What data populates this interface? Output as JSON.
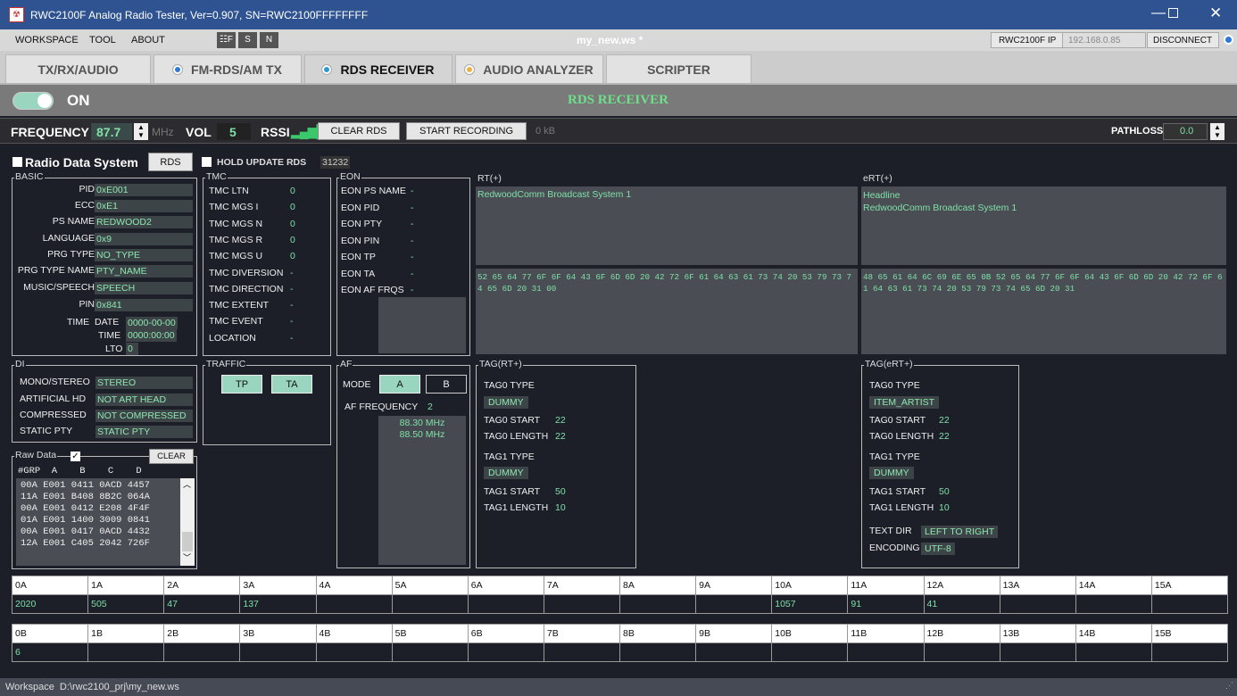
{
  "window": {
    "title": "RWC2100F Analog Radio Tester, Ver=0.907, SN=RWC2100FFFFFFFF"
  },
  "menu": {
    "items": [
      "WORKSPACE",
      "TOOL",
      "ABOUT"
    ],
    "workspace_name": "my_new.ws *",
    "ip_label": "RWC2100F IP",
    "ip_value": "192.168.0.85",
    "disconnect": "DISCONNECT"
  },
  "tabs": [
    {
      "label": "TX/RX/AUDIO"
    },
    {
      "label": "FM-RDS/AM TX"
    },
    {
      "label": "RDS RECEIVER"
    },
    {
      "label": "AUDIO ANALYZER"
    },
    {
      "label": "SCRIPTER"
    }
  ],
  "onbar": {
    "toggle": "ON",
    "title": "RDS RECEIVER"
  },
  "freqbar": {
    "freq_label": "FREQUENCY",
    "freq": "87.7",
    "unit": "MHz",
    "vol_label": "VOL",
    "vol": "5",
    "rssi_label": "RSSI",
    "clear_rds": "CLEAR RDS",
    "start_rec": "START RECORDING",
    "size": "0 kB",
    "pathloss_label": "PATHLOSS",
    "pathloss": "0.0"
  },
  "rds": {
    "title": "Radio Data System",
    "rds_btn": "RDS",
    "hold": "HOLD UPDATE RDS",
    "hold_count": "31232"
  },
  "basic": {
    "label": "BASIC",
    "pid_l": "PID",
    "pid": "0xE001",
    "ecc_l": "ECC",
    "ecc": "0xE1",
    "ps_l": "PS NAME",
    "ps": "REDWOOD2",
    "lang_l": "LANGUAGE",
    "lang": "0x9",
    "pty_l": "PRG TYPE",
    "pty": "NO_TYPE",
    "ptyn_l": "PRG TYPE NAME",
    "ptyn": "PTY_NAME",
    "ms_l": "MUSIC/SPEECH",
    "ms": "SPEECH",
    "pin_l": "PIN",
    "pin": "0x841",
    "time_l": "TIME",
    "date_l": "DATE",
    "date": "0000-00-00",
    "tm_l": "TIME",
    "tm": "0000:00:00",
    "lto_l": "LTO",
    "lto": "0"
  },
  "tmc": {
    "label": "TMC",
    "rows": [
      [
        "TMC LTN",
        "0"
      ],
      [
        "TMC MGS I",
        "0"
      ],
      [
        "TMC MGS N",
        "0"
      ],
      [
        "TMC MGS R",
        "0"
      ],
      [
        "TMC MGS U",
        "0"
      ],
      [
        "TMC DIVERSION",
        "-"
      ],
      [
        "TMC DIRECTION",
        "-"
      ],
      [
        "TMC EXTENT",
        "-"
      ],
      [
        "TMC EVENT",
        "-"
      ],
      [
        "LOCATION",
        "-"
      ]
    ]
  },
  "eon": {
    "label": "EON",
    "rows": [
      [
        "EON PS NAME",
        "-"
      ],
      [
        "EON PID",
        "-"
      ],
      [
        "EON PTY",
        "-"
      ],
      [
        "EON PIN",
        "-"
      ],
      [
        "EON TP",
        "-"
      ],
      [
        "EON TA",
        "-"
      ],
      [
        "EON AF FRQS",
        "-"
      ]
    ]
  },
  "rt": {
    "label": "RT(+)",
    "text": "RedwoodComm Broadcast System 1",
    "hex": "52 65 64 77 6F 6F 64 43 6F 6D 6D 20 42 72 6F 61 64 63 61 73 74 20 53 79 73 74 65 6D 20 31 00"
  },
  "ert": {
    "label": "eRT(+)",
    "text1": "Headline",
    "text2": "RedwoodComm Broadcast System 1",
    "hex": "48 65 61 64 6C 69 6E 65 0B 52 65 64 77 6F 6F 64 43 6F 6D 6D 20 42 72 6F 61 64 63 61 73 74 20 53 79 73 74 65 6D 20 31"
  },
  "di": {
    "label": "DI",
    "ms_l": "MONO/STEREO",
    "ms": "STEREO",
    "ah_l": "ARTIFICIAL HD",
    "ah": "NOT ART HEAD",
    "cp_l": "COMPRESSED",
    "cp": "NOT COMPRESSED",
    "sp_l": "STATIC PTY",
    "sp": "STATIC PTY"
  },
  "traffic": {
    "label": "TRAFFIC",
    "tp": "TP",
    "ta": "TA"
  },
  "af": {
    "label": "AF",
    "mode_l": "MODE",
    "a": "A",
    "b": "B",
    "freq_l": "AF FREQUENCY",
    "count": "2",
    "list": [
      "88.30 MHz",
      "88.50 MHz"
    ]
  },
  "tagrt": {
    "label": "TAG(RT+)",
    "t0type_l": "TAG0 TYPE",
    "t0type": "DUMMY",
    "t0start_l": "TAG0 START",
    "t0start": "22",
    "t0len_l": "TAG0 LENGTH",
    "t0len": "22",
    "t1type_l": "TAG1 TYPE",
    "t1type": "DUMMY",
    "t1start_l": "TAG1 START",
    "t1start": "50",
    "t1len_l": "TAG1 LENGTH",
    "t1len": "10"
  },
  "tagert": {
    "label": "TAG(eRT+)",
    "t0type_l": "TAG0 TYPE",
    "t0type": "ITEM_ARTIST",
    "t0start_l": "TAG0 START",
    "t0start": "22",
    "t0len_l": "TAG0 LENGTH",
    "t0len": "22",
    "t1type_l": "TAG1 TYPE",
    "t1type": "DUMMY",
    "t1start_l": "TAG1 START",
    "t1start": "50",
    "t1len_l": "TAG1 LENGTH",
    "t1len": "10",
    "dir_l": "TEXT DIR",
    "dir": "LEFT TO RIGHT",
    "enc_l": "ENCODING",
    "enc": "UTF-8"
  },
  "raw": {
    "label": "Raw Data",
    "clear": "CLEAR",
    "header": "#GRP  A    B    C    D",
    "lines": [
      "00A E001 0411 0ACD 4457",
      "11A E001 B408 8B2C 064A",
      "00A E001 0412 E208 4F4F",
      "01A E001 1400 3009 0841",
      "00A E001 0417 0ACD 4432",
      "12A E001 C405 2042 726F"
    ]
  },
  "groups_a": {
    "headers": [
      "0A",
      "1A",
      "2A",
      "3A",
      "4A",
      "5A",
      "6A",
      "7A",
      "8A",
      "9A",
      "10A",
      "11A",
      "12A",
      "13A",
      "14A",
      "15A"
    ],
    "counts": [
      "2020",
      "505",
      "47",
      "137",
      "",
      "",
      "",
      "",
      "",
      "",
      "1057",
      "91",
      "41",
      "",
      "",
      ""
    ]
  },
  "groups_b": {
    "headers": [
      "0B",
      "1B",
      "2B",
      "3B",
      "4B",
      "5B",
      "6B",
      "7B",
      "8B",
      "9B",
      "10B",
      "11B",
      "12B",
      "13B",
      "14B",
      "15B"
    ],
    "counts": [
      "6",
      "",
      "",
      "",
      "",
      "",
      "",
      "",
      "",
      "",
      "",
      "",
      "",
      "",
      "",
      ""
    ]
  },
  "status": {
    "text": "Workspace  D:\\rwc2100_prj\\my_new.ws"
  }
}
